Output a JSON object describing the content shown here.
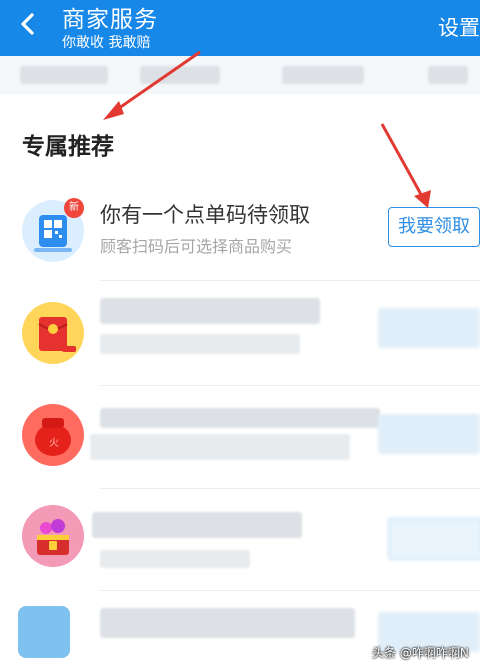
{
  "header": {
    "title": "商家服务",
    "subtitle": "你敢收 我敢赔",
    "settings_label": "设置"
  },
  "section": {
    "title": "专属推荐"
  },
  "recommendations": [
    {
      "icon": "qr-code-icon",
      "badge": "新",
      "title": "你有一个点单码待领取",
      "subtitle": "顾客扫码后可选择商品购买",
      "button_label": "我要领取"
    },
    {
      "icon": "red-envelope-icon"
    },
    {
      "icon": "red-pouch-icon"
    },
    {
      "icon": "treasure-chest-icon"
    },
    {
      "icon": "blue-card-icon"
    }
  ],
  "watermark": "头条 @咋啊咋啊N",
  "colors": {
    "header_bg": "#1787e8",
    "accent": "#2f8fe6",
    "annotation_arrow": "#e23a33"
  }
}
